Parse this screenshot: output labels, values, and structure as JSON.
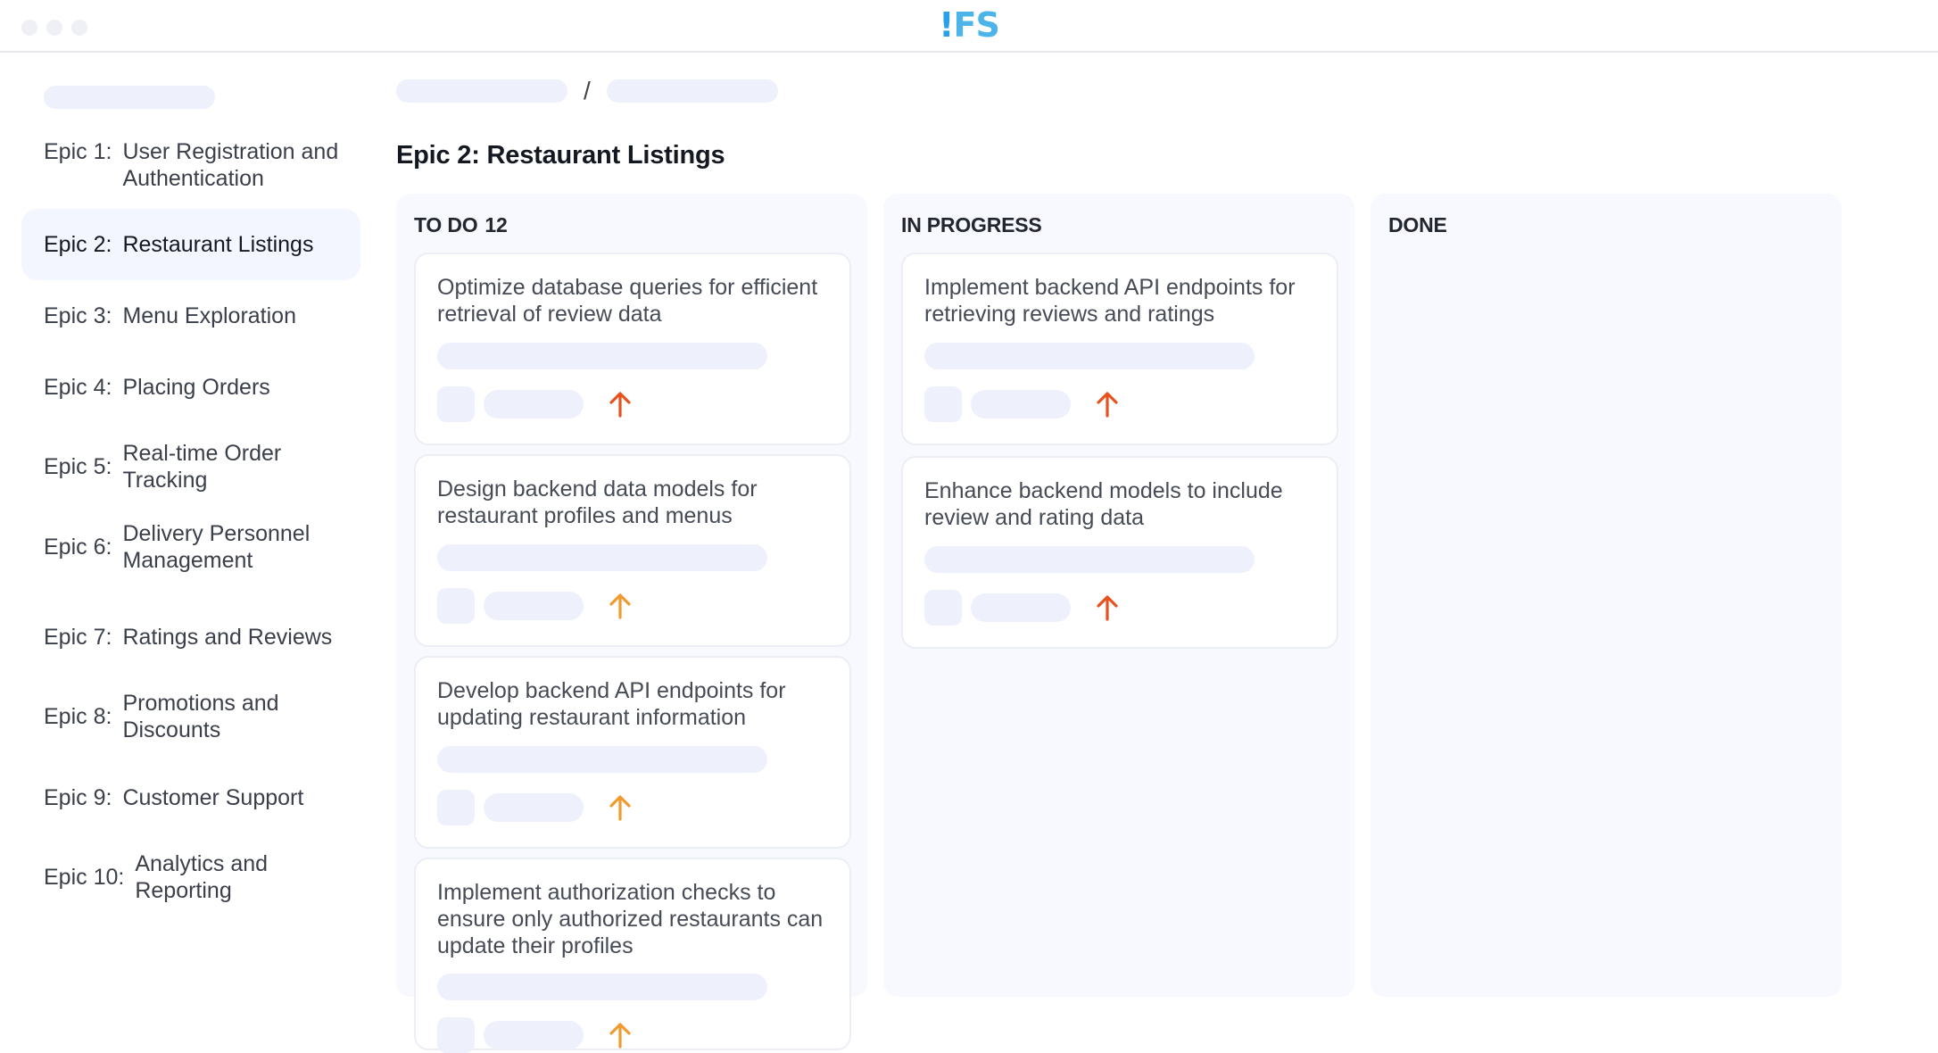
{
  "app": {
    "logo_bang": "!",
    "logo_rest": "FS"
  },
  "sidebar": {
    "items": [
      {
        "num": "Epic 1:",
        "title": "User Registration and Authentication",
        "active": false
      },
      {
        "num": "Epic 2:",
        "title": "Restaurant Listings",
        "active": true
      },
      {
        "num": "Epic 3:",
        "title": "Menu Exploration",
        "active": false
      },
      {
        "num": "Epic 4:",
        "title": "Placing Orders",
        "active": false
      },
      {
        "num": "Epic 5:",
        "title": "Real-time Order Tracking",
        "active": false
      },
      {
        "num": "Epic 6:",
        "title": "Delivery Personnel Management",
        "active": false
      },
      {
        "num": "Epic 7:",
        "title": "Ratings and Reviews",
        "active": false
      },
      {
        "num": "Epic 8:",
        "title": "Promotions and Discounts",
        "active": false
      },
      {
        "num": "Epic 9:",
        "title": "Customer Support",
        "active": false
      },
      {
        "num": "Epic 10:",
        "title": "Analytics and Reporting",
        "active": false
      }
    ]
  },
  "breadcrumb": {
    "separator": "/"
  },
  "page": {
    "title": "Epic 2: Restaurant Listings"
  },
  "board": {
    "columns": [
      {
        "name": "TO DO",
        "count": "12",
        "cards": [
          {
            "title": "Optimize database queries for efficient retrieval of review data",
            "priority": "high"
          },
          {
            "title": "Design backend data models for restaurant profiles and menus",
            "priority": "medium"
          },
          {
            "title": "Develop backend API endpoints for updating restaurant information",
            "priority": "medium"
          },
          {
            "title": "Implement authorization checks to ensure only authorized restaurants can update their profiles",
            "priority": "medium"
          }
        ]
      },
      {
        "name": "IN PROGRESS",
        "count": "",
        "cards": [
          {
            "title": "Implement backend API endpoints for retrieving reviews and ratings",
            "priority": "high"
          },
          {
            "title": "Enhance backend models to include review and rating data",
            "priority": "high"
          }
        ]
      },
      {
        "name": "DONE",
        "count": "",
        "cards": []
      }
    ]
  },
  "colors": {
    "priority_high": "#e8501e",
    "priority_medium": "#f09a30",
    "skeleton": "#eef1fb",
    "column_bg": "#f8f9fe",
    "logo": "#2aa0e8"
  },
  "icons": {
    "priority": "arrow-up-icon"
  }
}
